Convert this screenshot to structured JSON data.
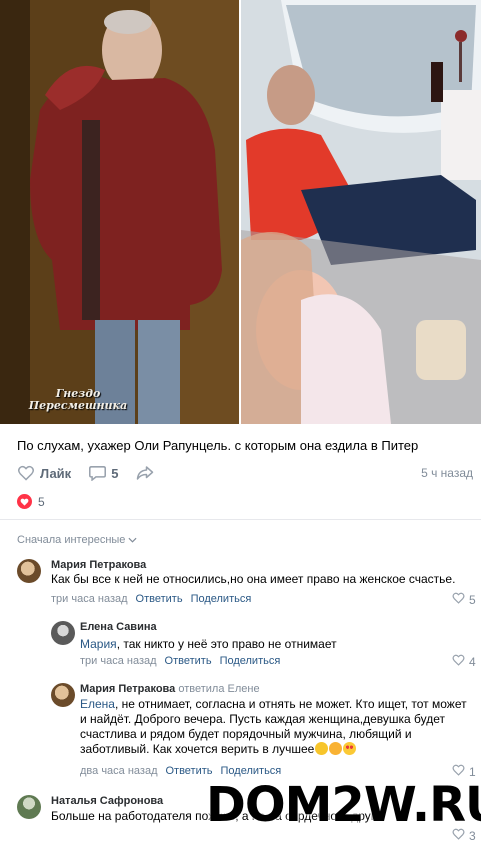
{
  "photos": {
    "watermark": "Гнездо Пересмешника"
  },
  "post": {
    "text": "По слухам, ухажер Оли Рапунцель. с которым она ездила в Питер",
    "like_label": "Лайк",
    "comment_count": "5",
    "time": "5 ч назад",
    "likes_total": "5"
  },
  "comments_header": {
    "sort_label": "Сначала интересные"
  },
  "comments": [
    {
      "author": "Мария Петракова",
      "text": "Как бы все к ней не относились,но она имеет право на женское счастье.",
      "time": "три часа назад",
      "reply_label": "Ответить",
      "share_label": "Поделиться",
      "likes": "5"
    },
    {
      "author": "Елена Савина",
      "mention": "Мария",
      "text": ", так никто у неё это право не отнимает",
      "time": "три часа назад",
      "reply_label": "Ответить",
      "share_label": "Поделиться",
      "likes": "4"
    },
    {
      "author": "Мария Петракова",
      "reply_to": "ответила Елене",
      "mention": "Елена",
      "text": ", не отнимает, согласна и отнять не может. Кто ищет, тот может и найдёт. Доброго вечера. Пусть каждая женщина,девушка будет счастлива и рядом будет порядочный мужчина, любящий и заботливый. Как хочется верить в лучшее",
      "time": "два часа назад",
      "reply_label": "Ответить",
      "share_label": "Поделиться",
      "likes": "1"
    },
    {
      "author": "Наталья Сафронова",
      "text": "Больше на работодателя похоже, а не на сердечного друга.",
      "likes": "3"
    }
  ],
  "site_watermark": "DOM2W.RU"
}
